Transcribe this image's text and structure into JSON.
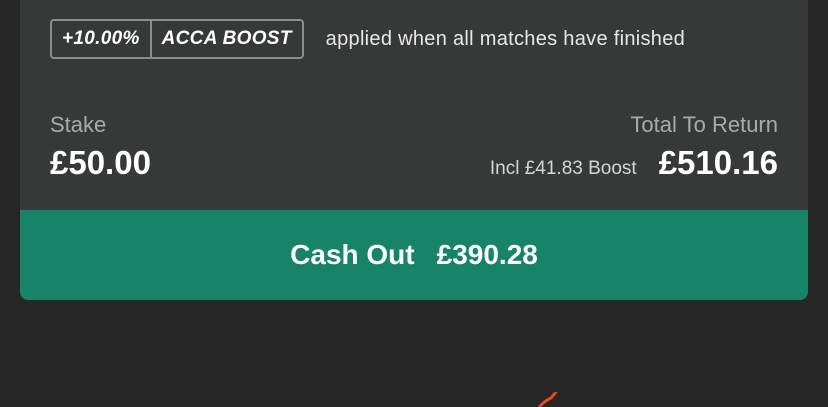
{
  "boost": {
    "percentage": "+10.00%",
    "name": "ACCA BOOST",
    "note": "applied when all matches have finished"
  },
  "stake": {
    "label": "Stake",
    "value": "£50.00"
  },
  "total_return": {
    "label": "Total To Return",
    "boost_included": "Incl £41.83 Boost",
    "value": "£510.16"
  },
  "cash_out": {
    "label": "Cash Out",
    "amount": "£390.28"
  },
  "colors": {
    "background": "#262626",
    "card": "#363938",
    "cash_out_green": "#168466",
    "accent_orange": "#e8471c"
  }
}
